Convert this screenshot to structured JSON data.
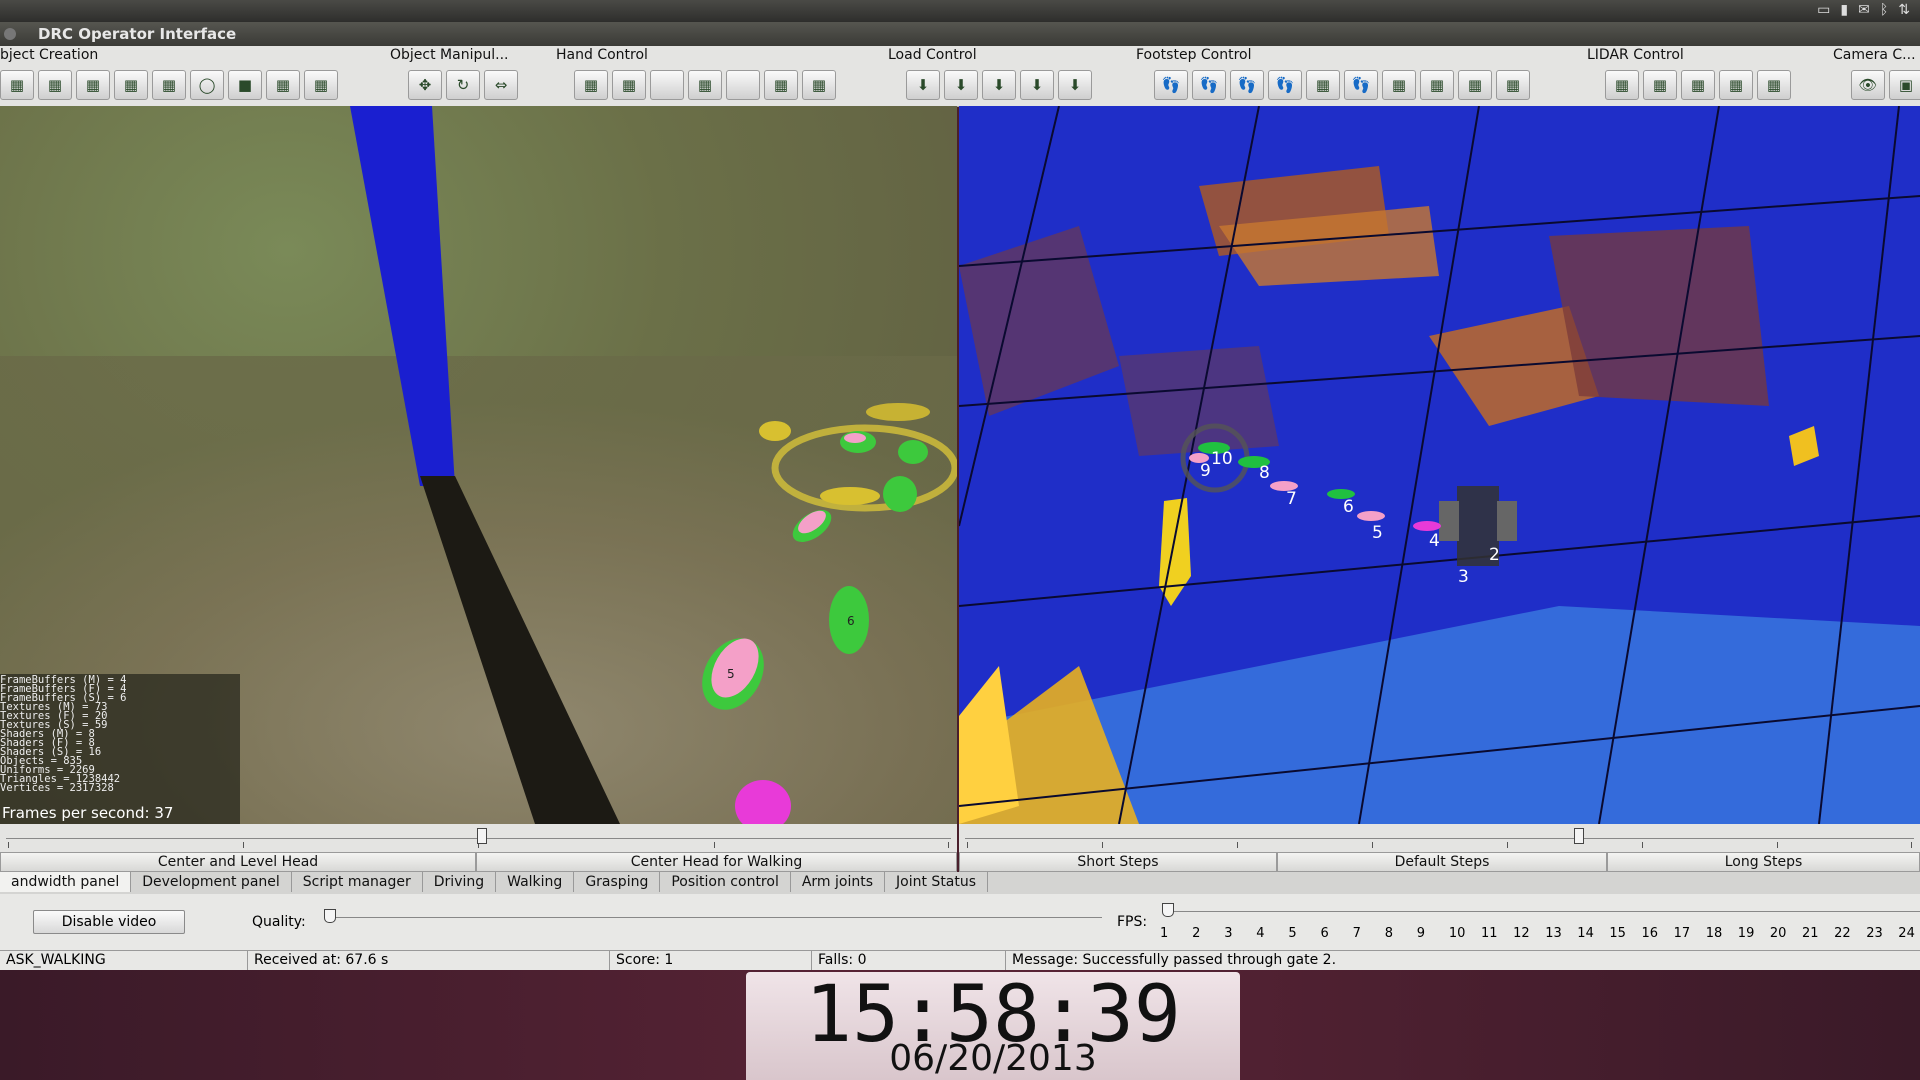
{
  "window": {
    "title": "DRC Operator Interface"
  },
  "toolbar_groups": [
    {
      "title": "bject Creation",
      "icons": [
        "select-icon",
        "cube-icon",
        "grid-icon",
        "vehicle-icon",
        "update-vehicle-icon",
        "ring-icon",
        "green-box-icon",
        "drill-icon",
        "valve-icon"
      ]
    },
    {
      "title": "Object Manipul...",
      "icons": [
        "move-icon",
        "rotate-icon",
        "align-icon"
      ]
    },
    {
      "title": "Hand Control",
      "icons": [
        "hand-place-icon",
        "hand-close-icon",
        "blank-icon",
        "hand-home-icon",
        "blank-icon",
        "hand-close-icon",
        "hand-place-icon"
      ]
    },
    {
      "title": "Load Control",
      "icons": [
        "load-icon",
        "load-icon",
        "load-icon",
        "load-icon",
        "load-icon"
      ]
    },
    {
      "title": "Footstep Control",
      "icons": [
        "footstep-icon",
        "footstep-icon",
        "footstep-icon",
        "footstep-icon",
        "footstep-grid-icon",
        "footstep-icon",
        "footstep-delete-icon",
        "snap-icon",
        "rotate-step-icon",
        "send-icon"
      ]
    },
    {
      "title": "LIDAR Control",
      "icons": [
        "lidar-icon",
        "lidar-clear-icon",
        "lidar-icon",
        "lidar-icon",
        "lidar-black-icon"
      ]
    },
    {
      "title": "Camera C...",
      "icons": [
        "eye-icon",
        "camera-icon"
      ]
    }
  ],
  "left_view": {
    "stats": [
      "FrameBuffers (M) = 4",
      "FrameBuffers (F) = 4",
      "FrameBuffers (S) = 6",
      "Textures (M) = 73",
      "Textures (F) = 20",
      "Textures (S) = 59",
      "Shaders (M) = 8",
      "Shaders (F) = 8",
      "Shaders (S) = 16",
      "Objects = 835",
      "Uniforms = 2269",
      "Triangles = 1238442",
      "Vertices = 2317328"
    ],
    "fps_text": "Frames per second: 37",
    "footstep_labels": [
      "5",
      "6"
    ]
  },
  "right_view": {
    "footstep_labels": [
      "10",
      "9",
      "8",
      "7",
      "6",
      "5",
      "4",
      "3",
      "2"
    ]
  },
  "head_presets": [
    "Center and Level Head",
    "Center Head for Walking"
  ],
  "step_presets": [
    "Short Steps",
    "Default Steps",
    "Long Steps"
  ],
  "tabs": [
    "andwidth panel",
    "Development panel",
    "Script manager",
    "Driving",
    "Walking",
    "Grasping",
    "Position control",
    "Arm joints",
    "Joint Status"
  ],
  "selected_tab": 0,
  "controls": {
    "disable_video": "Disable video",
    "quality_label": "Quality:",
    "fps_label": "FPS:",
    "fps_values": [
      "1",
      "2",
      "3",
      "4",
      "5",
      "6",
      "7",
      "8",
      "9",
      "10",
      "11",
      "12",
      "13",
      "14",
      "15",
      "16",
      "17",
      "18",
      "19",
      "20",
      "21",
      "22",
      "23",
      "24"
    ]
  },
  "status": {
    "task": "ASK_WALKING",
    "received": "Received at:  67.6 s",
    "score": "Score:  1",
    "falls": "Falls:  0",
    "message": "Message:  Successfully passed through gate 2."
  },
  "clock": {
    "time": "15:58:39",
    "date": "06/20/2013"
  }
}
